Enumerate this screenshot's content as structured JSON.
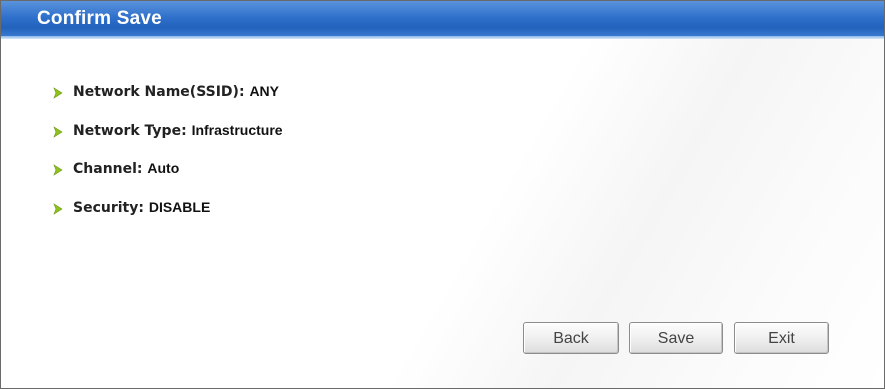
{
  "dialog": {
    "title": "Confirm Save"
  },
  "summary": {
    "items": [
      {
        "label": "Network Name(SSID):",
        "value": "ANY"
      },
      {
        "label": "Network Type:",
        "value": "Infrastructure"
      },
      {
        "label": "Channel:",
        "value": "Auto"
      },
      {
        "label": "Security:",
        "value": "DISABLE"
      }
    ]
  },
  "buttons": {
    "back_label": "Back",
    "save_label": "Save",
    "exit_label": "Exit"
  },
  "colors": {
    "title_bar": "#2d6fca",
    "bullet_arrow": "#8fc21b"
  },
  "icons": {
    "bullet": "chevron-right-icon"
  }
}
